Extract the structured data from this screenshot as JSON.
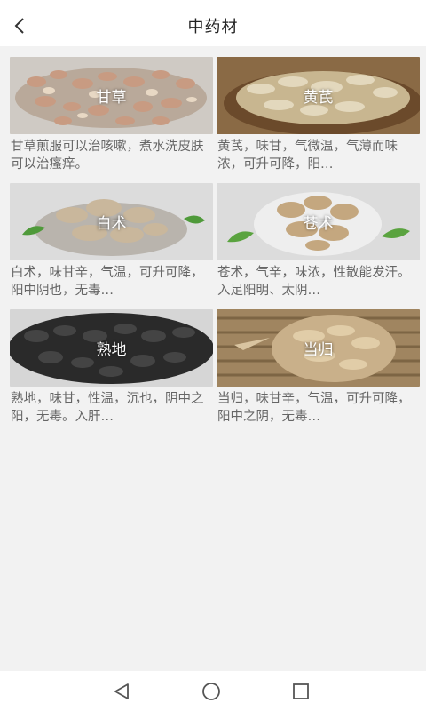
{
  "header": {
    "title": "中药材",
    "back_icon": "chevron-left-icon"
  },
  "herbs": [
    {
      "name": "甘草",
      "desc": "甘草煎服可以治咳嗽，煮水洗皮肤可以治瘙痒。"
    },
    {
      "name": "黄芪",
      "desc": "黄芪，味甘，气微温，气薄而味浓，可升可降，阳…"
    },
    {
      "name": "白术",
      "desc": "白术，味甘辛，气温，可升可降，阳中阴也，无毒…"
    },
    {
      "name": "苍术",
      "desc": "苍术，气辛，味浓，性散能发汗。入足阳明、太阴…"
    },
    {
      "name": "熟地",
      "desc": "熟地，味甘，性温，沉也，阴中之阳，无毒。入肝…"
    },
    {
      "name": "当归",
      "desc": "当归，味甘辛，气温，可升可降，阳中之阴，无毒…"
    }
  ],
  "navbar": {
    "back_icon": "triangle-back-icon",
    "home_icon": "circle-home-icon",
    "recents_icon": "square-recents-icon"
  },
  "colors": {
    "background": "#f2f2f2",
    "header_bg": "#ffffff",
    "desc_text": "#666666"
  }
}
